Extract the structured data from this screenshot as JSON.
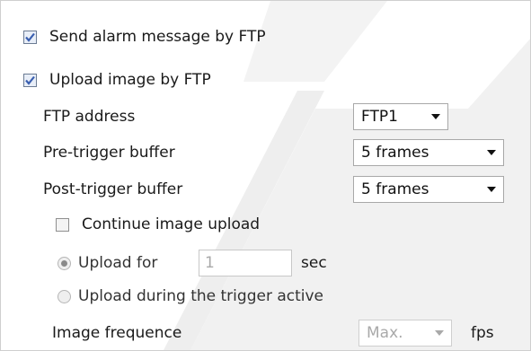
{
  "send_alarm": {
    "label": "Send alarm message by FTP",
    "checked": true
  },
  "upload_image": {
    "label": "Upload image by FTP",
    "checked": true
  },
  "ftp_address": {
    "label": "FTP address",
    "value": "FTP1"
  },
  "pre_trigger": {
    "label": "Pre-trigger buffer",
    "value": "5 frames"
  },
  "post_trigger": {
    "label": "Post-trigger buffer",
    "value": "5 frames"
  },
  "continue_upload": {
    "label": "Continue image upload",
    "checked": false
  },
  "upload_for": {
    "label": "Upload for",
    "value": "1",
    "unit": "sec",
    "selected": true
  },
  "upload_during": {
    "label": "Upload during the trigger active",
    "selected": false
  },
  "image_frequence": {
    "label": "Image frequence",
    "value": "Max.",
    "unit": "fps"
  },
  "colors": {
    "check": "#3a5fb0",
    "watermark": "#ececec"
  }
}
